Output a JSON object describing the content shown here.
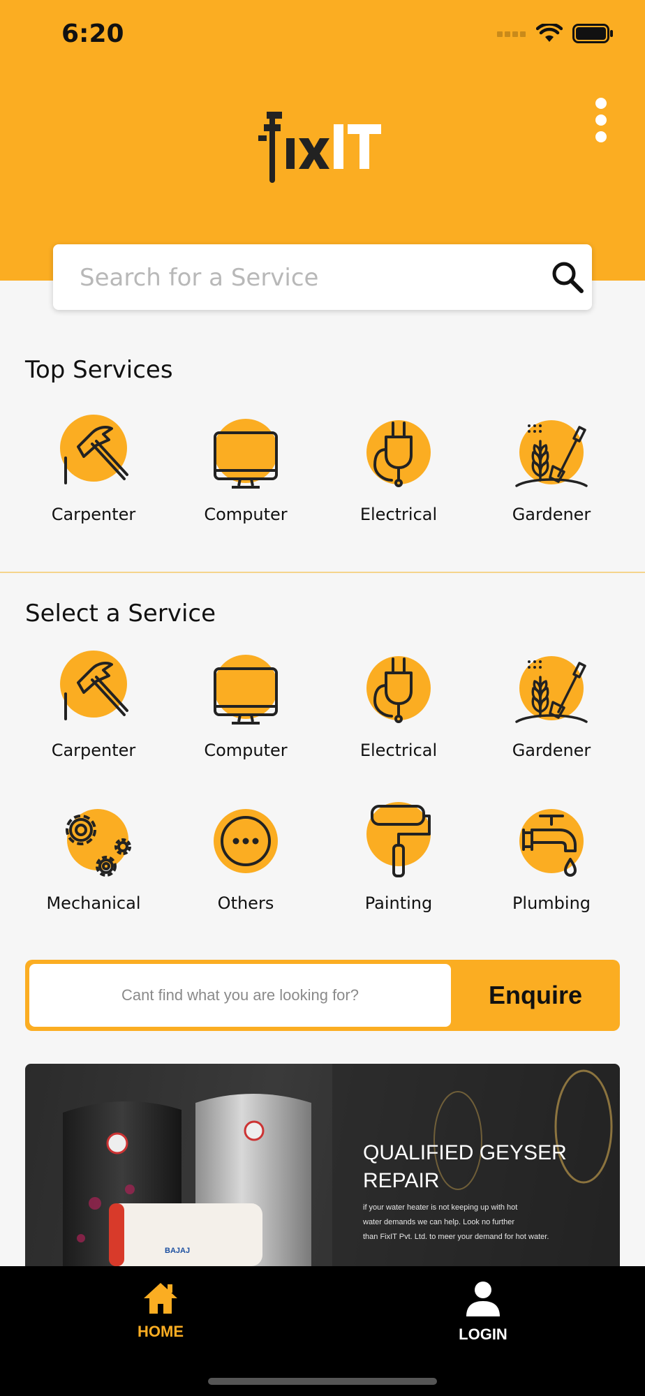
{
  "status": {
    "time": "6:20"
  },
  "header": {
    "logo_text": "fixIT"
  },
  "search": {
    "placeholder": "Search for a Service",
    "value": ""
  },
  "top_services": {
    "title": "Top Services",
    "items": [
      {
        "label": "Carpenter",
        "icon": "hammer-icon"
      },
      {
        "label": "Computer",
        "icon": "monitor-icon"
      },
      {
        "label": "Electrical",
        "icon": "plug-icon"
      },
      {
        "label": "Gardener",
        "icon": "plant-shovel-icon"
      }
    ]
  },
  "select_service": {
    "title": "Select a Service",
    "items": [
      {
        "label": "Carpenter",
        "icon": "hammer-icon"
      },
      {
        "label": "Computer",
        "icon": "monitor-icon"
      },
      {
        "label": "Electrical",
        "icon": "plug-icon"
      },
      {
        "label": "Gardener",
        "icon": "plant-shovel-icon"
      },
      {
        "label": "Mechanical",
        "icon": "gears-icon"
      },
      {
        "label": "Others",
        "icon": "more-dots-icon"
      },
      {
        "label": "Painting",
        "icon": "paint-roller-icon"
      },
      {
        "label": "Plumbing",
        "icon": "faucet-icon"
      }
    ]
  },
  "enquire": {
    "placeholder": "Cant find what you are looking for?",
    "button": "Enquire"
  },
  "banner": {
    "title_line1": "QUALIFIED GEYSER",
    "title_line2": "REPAIR",
    "text_line1": "if your water heater is not keeping up with hot",
    "text_line2": "water demands we can help. Look no further",
    "text_line3": "than FixIT Pvt. Ltd. to meer your demand for hot water.",
    "brand": "BAJAJ"
  },
  "nav": {
    "home": "HOME",
    "login": "LOGIN"
  },
  "colors": {
    "accent": "#fbad22",
    "dark": "#222222",
    "background": "#f6f6f6"
  }
}
